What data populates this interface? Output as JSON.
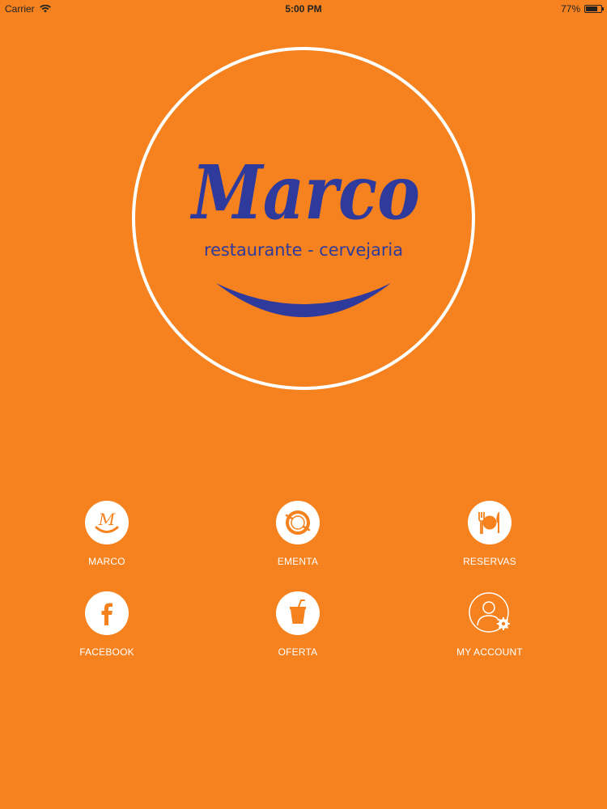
{
  "status_bar": {
    "carrier": "Carrier",
    "time": "5:00 PM",
    "battery": "77%",
    "battery_level": 0.77
  },
  "logo": {
    "brand": "Marco",
    "tagline": "restaurante - cervejaria"
  },
  "colors": {
    "background": "#f5821f",
    "logo_blue": "#2e3a9c",
    "white": "#ffffff"
  },
  "menu": {
    "items": [
      {
        "label": "MARCO",
        "icon": "marco-logo-icon"
      },
      {
        "label": "EMENTA",
        "icon": "plate-icon"
      },
      {
        "label": "RESERVAS",
        "icon": "cutlery-icon"
      },
      {
        "label": "FACEBOOK",
        "icon": "facebook-icon"
      },
      {
        "label": "OFERTA",
        "icon": "drink-cup-icon"
      },
      {
        "label": "MY ACCOUNT",
        "icon": "user-settings-icon"
      }
    ]
  }
}
